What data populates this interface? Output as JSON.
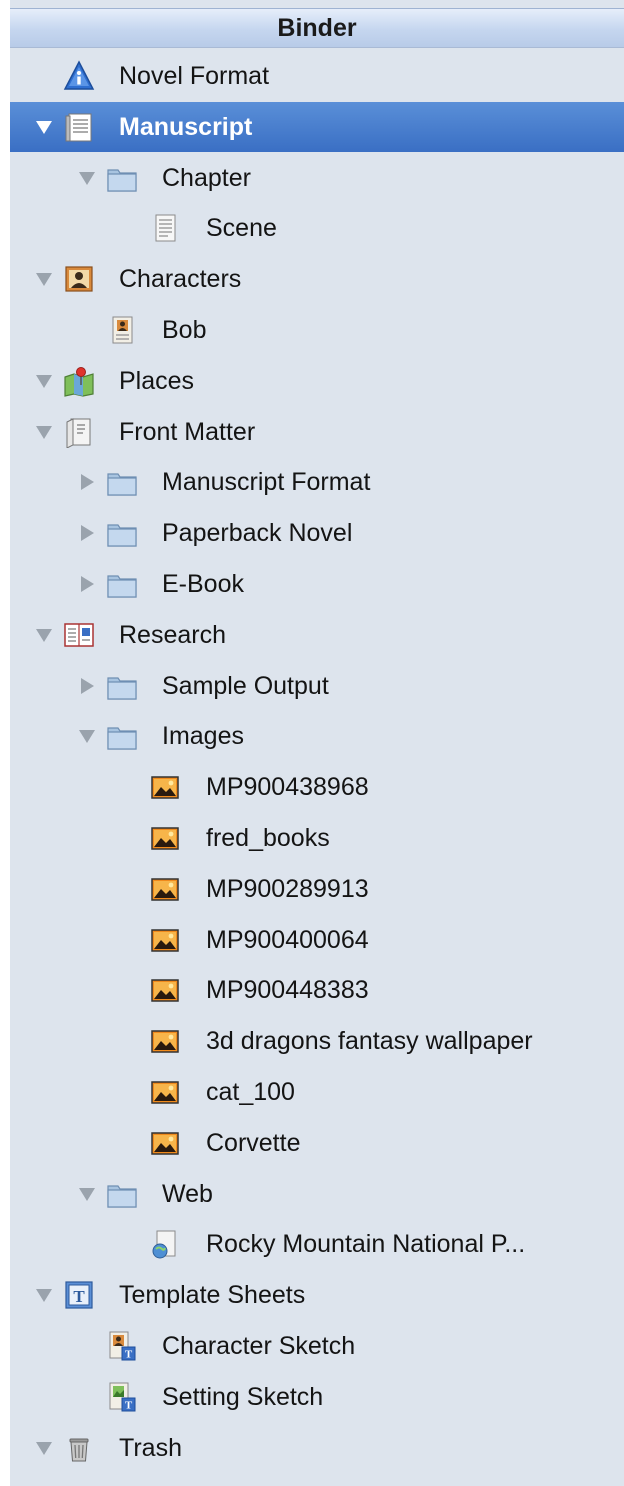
{
  "binder": {
    "title": "Binder",
    "items": [
      {
        "label": "Novel Format",
        "icon": "info-icon",
        "depth": 0,
        "triangle": "none"
      },
      {
        "label": "Manuscript",
        "icon": "manuscript-icon",
        "depth": 0,
        "triangle": "down",
        "selected": true
      },
      {
        "label": "Chapter",
        "icon": "folder-icon",
        "depth": 1,
        "triangle": "down"
      },
      {
        "label": "Scene",
        "icon": "document-icon",
        "depth": 2,
        "triangle": "none"
      },
      {
        "label": "Characters",
        "icon": "characters-icon",
        "depth": 0,
        "triangle": "down"
      },
      {
        "label": "Bob",
        "icon": "character-card-icon",
        "depth": 1,
        "triangle": "none"
      },
      {
        "label": "Places",
        "icon": "places-icon",
        "depth": 0,
        "triangle": "down"
      },
      {
        "label": "Front Matter",
        "icon": "front-matter-icon",
        "depth": 0,
        "triangle": "down"
      },
      {
        "label": "Manuscript Format",
        "icon": "folder-icon",
        "depth": 1,
        "triangle": "right"
      },
      {
        "label": "Paperback Novel",
        "icon": "folder-icon",
        "depth": 1,
        "triangle": "right"
      },
      {
        "label": "E-Book",
        "icon": "folder-icon",
        "depth": 1,
        "triangle": "right"
      },
      {
        "label": "Research",
        "icon": "research-icon",
        "depth": 0,
        "triangle": "down"
      },
      {
        "label": "Sample Output",
        "icon": "folder-icon",
        "depth": 1,
        "triangle": "right"
      },
      {
        "label": "Images",
        "icon": "folder-icon",
        "depth": 1,
        "triangle": "down"
      },
      {
        "label": "MP900438968",
        "icon": "image-icon",
        "depth": 2,
        "triangle": "none"
      },
      {
        "label": "fred_books",
        "icon": "image-icon",
        "depth": 2,
        "triangle": "none"
      },
      {
        "label": "MP900289913",
        "icon": "image-icon",
        "depth": 2,
        "triangle": "none"
      },
      {
        "label": "MP900400064",
        "icon": "image-icon",
        "depth": 2,
        "triangle": "none"
      },
      {
        "label": "MP900448383",
        "icon": "image-icon",
        "depth": 2,
        "triangle": "none"
      },
      {
        "label": "3d dragons fantasy wallpaper",
        "icon": "image-icon",
        "depth": 2,
        "triangle": "none"
      },
      {
        "label": "cat_100",
        "icon": "image-icon",
        "depth": 2,
        "triangle": "none"
      },
      {
        "label": "Corvette",
        "icon": "image-icon",
        "depth": 2,
        "triangle": "none"
      },
      {
        "label": "Web",
        "icon": "folder-icon",
        "depth": 1,
        "triangle": "down"
      },
      {
        "label": "Rocky Mountain National P...",
        "icon": "webpage-icon",
        "depth": 2,
        "triangle": "none"
      },
      {
        "label": "Template Sheets",
        "icon": "template-icon",
        "depth": 0,
        "triangle": "down"
      },
      {
        "label": "Character Sketch",
        "icon": "character-sketch-icon",
        "depth": 1,
        "triangle": "none"
      },
      {
        "label": "Setting Sketch",
        "icon": "setting-sketch-icon",
        "depth": 1,
        "triangle": "none"
      },
      {
        "label": "Trash",
        "icon": "trash-icon",
        "depth": 0,
        "triangle": "down"
      }
    ]
  },
  "colors": {
    "background": "#dde4ed",
    "header": "#c5d6ef",
    "selection": "#3a6fc4",
    "text": "#141414",
    "selected_text": "#ffffff"
  }
}
